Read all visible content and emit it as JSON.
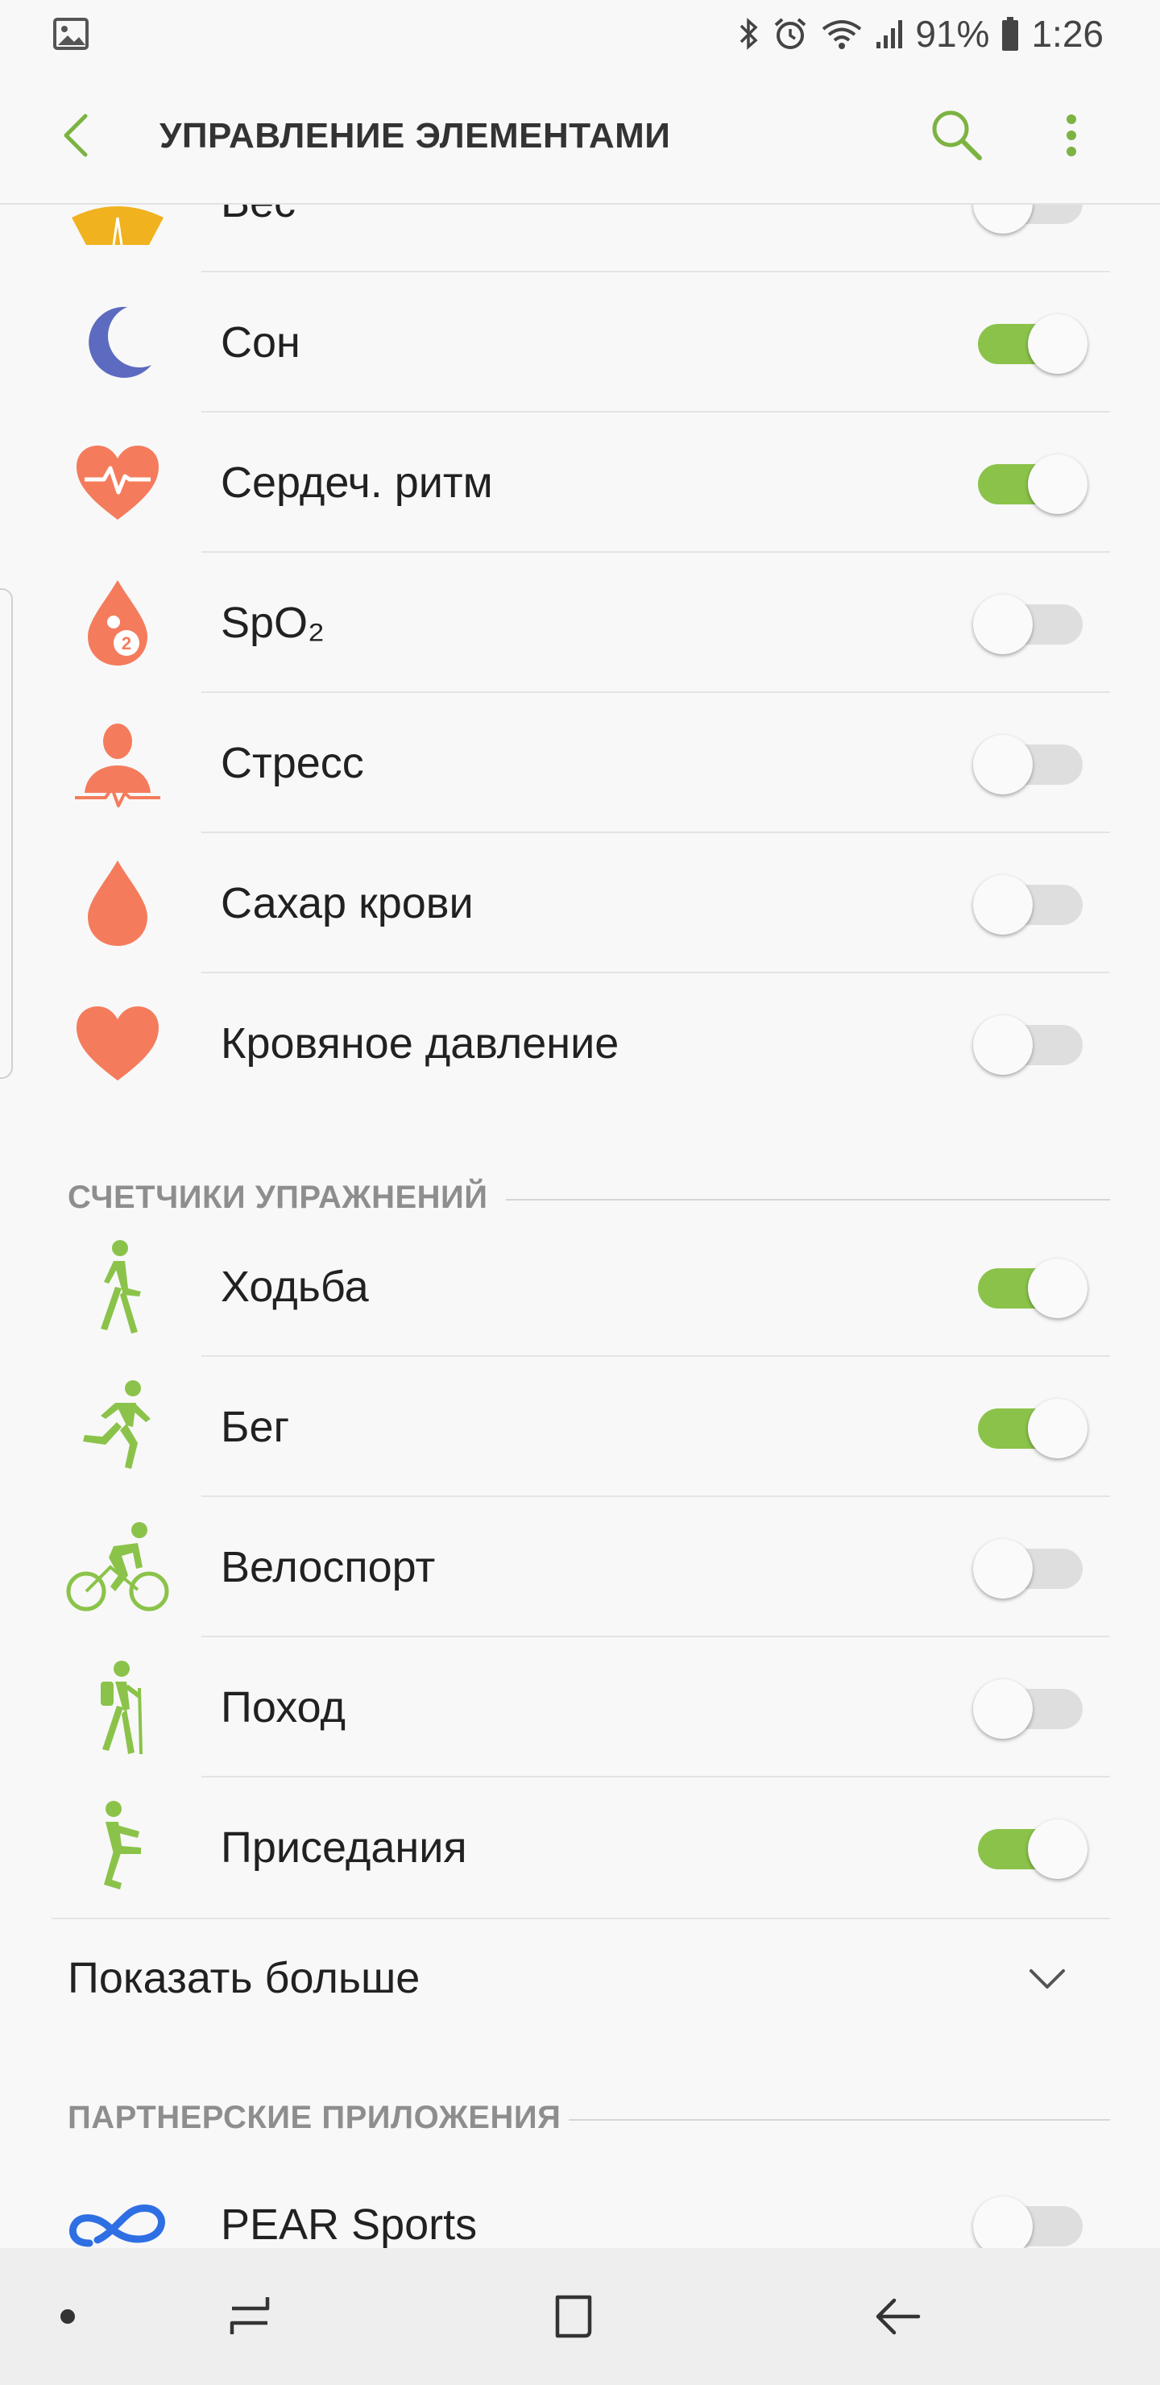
{
  "status_bar": {
    "battery": "91%",
    "time": "1:26",
    "icons": [
      "gallery-icon",
      "bluetooth-icon",
      "alarm-icon",
      "wifi-icon",
      "signal-icon",
      "battery-icon"
    ]
  },
  "app_bar": {
    "title": "УПРАВЛЕНИЕ ЭЛЕМЕНТАМИ",
    "back_icon": "back-arrow-icon",
    "search_icon": "search-icon",
    "more_icon": "more-vertical-icon"
  },
  "health_items": [
    {
      "label": "Вес",
      "icon": "weight-icon",
      "enabled": false
    },
    {
      "label": "Сон",
      "icon": "moon-icon",
      "enabled": true
    },
    {
      "label": "Сердеч. ритм",
      "icon": "heart-rate-icon",
      "enabled": true
    },
    {
      "label": "SpO₂",
      "icon": "blood-oxygen-icon",
      "enabled": false
    },
    {
      "label": "Стресс",
      "icon": "stress-icon",
      "enabled": false
    },
    {
      "label": "Сахар крови",
      "icon": "blood-drop-icon",
      "enabled": false
    },
    {
      "label": "Кровяное давление",
      "icon": "heart-icon",
      "enabled": false
    }
  ],
  "exercise_section": {
    "title": "СЧЕТЧИКИ УПРАЖНЕНИЙ",
    "items": [
      {
        "label": "Ходьба",
        "icon": "walking-icon",
        "enabled": true
      },
      {
        "label": "Бег",
        "icon": "running-icon",
        "enabled": true
      },
      {
        "label": "Велоспорт",
        "icon": "cycling-icon",
        "enabled": false
      },
      {
        "label": "Поход",
        "icon": "hiking-icon",
        "enabled": false
      },
      {
        "label": "Приседания",
        "icon": "squats-icon",
        "enabled": true
      }
    ],
    "show_more": "Показать больше"
  },
  "partner_section": {
    "title": "ПАРТНЕРСКИЕ ПРИЛОЖЕНИЯ",
    "items": [
      {
        "label": "PEAR Sports",
        "icon": "pear-sports-icon",
        "enabled": false
      }
    ]
  },
  "colors": {
    "accent": "#8bc34a",
    "toggle_off": "#dedede",
    "health_icon": "#f47c5c",
    "sleep_icon": "#5c6bc0",
    "weight_icon": "#f0b21f",
    "partner_icon": "#2f6fe4"
  },
  "nav_bar": {
    "icons": [
      "dot-icon",
      "recents-icon",
      "home-icon",
      "back-icon"
    ]
  }
}
